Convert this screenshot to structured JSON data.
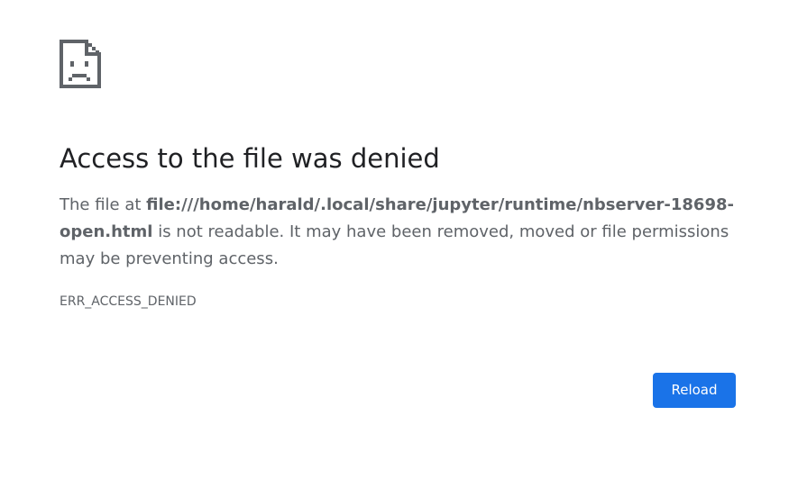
{
  "icon": "sad-document-icon",
  "title": "Access to the file was denied",
  "details": {
    "prefix": "The file at ",
    "path": "file:///home/harald/.local/share/jupyter/runtime/nbserver-18698-open.html",
    "suffix": " is not readable. It may have been removed, moved or file permissions may be preventing access."
  },
  "error_code": "ERR_ACCESS_DENIED",
  "reload_label": "Reload",
  "colors": {
    "accent": "#1a73e8",
    "title": "#202124",
    "body_text": "#5f6368",
    "icon": "#5f6368"
  }
}
